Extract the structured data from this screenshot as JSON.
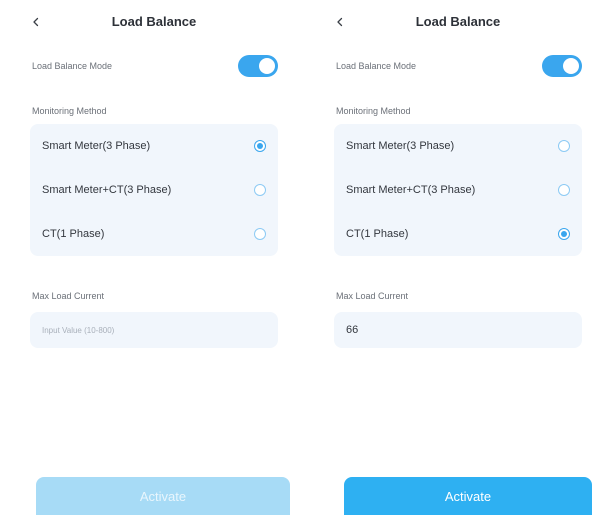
{
  "colors": {
    "accent": "#3aa6ee",
    "button_disabled": "#a7dbf6",
    "button_enabled": "#2eb0f2",
    "card_bg": "#f1f6fc"
  },
  "screens": [
    {
      "header": {
        "back_icon": "chevron-left-icon",
        "title": "Load Balance"
      },
      "mode": {
        "label": "Load Balance Mode",
        "enabled": true
      },
      "monitoring": {
        "label": "Monitoring Method",
        "options": [
          {
            "label": "Smart Meter(3 Phase)",
            "selected": true
          },
          {
            "label": "Smart Meter+CT(3 Phase)",
            "selected": false
          },
          {
            "label": "CT(1 Phase)",
            "selected": false
          }
        ]
      },
      "max_current": {
        "label": "Max Load Current",
        "value": "",
        "placeholder": "Input Value (10-800)"
      },
      "activate": {
        "label": "Activate",
        "state": "disabled"
      }
    },
    {
      "header": {
        "back_icon": "chevron-left-icon",
        "title": "Load Balance"
      },
      "mode": {
        "label": "Load Balance Mode",
        "enabled": true
      },
      "monitoring": {
        "label": "Monitoring Method",
        "options": [
          {
            "label": "Smart Meter(3 Phase)",
            "selected": false
          },
          {
            "label": "Smart Meter+CT(3 Phase)",
            "selected": false
          },
          {
            "label": "CT(1 Phase)",
            "selected": true
          }
        ]
      },
      "max_current": {
        "label": "Max Load Current",
        "value": "66",
        "placeholder": ""
      },
      "activate": {
        "label": "Activate",
        "state": "enabled"
      }
    }
  ]
}
